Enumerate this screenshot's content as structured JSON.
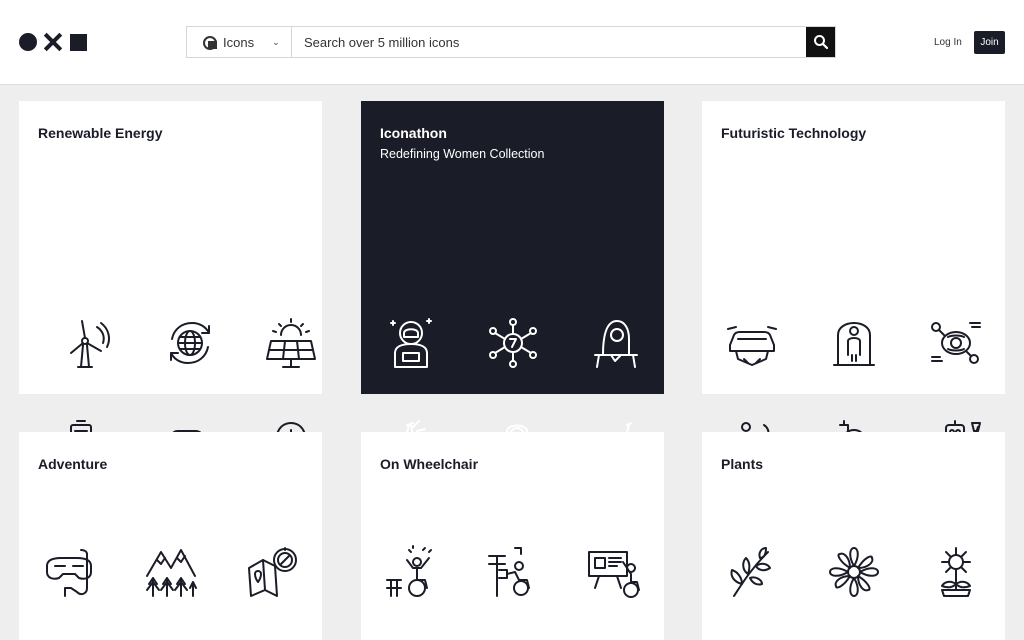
{
  "header": {
    "logo_icons": [
      "circle-icon",
      "cross-icon",
      "square-icon"
    ],
    "search": {
      "type_label": "Icons",
      "placeholder": "Search over 5 million icons"
    },
    "login_label": "Log In",
    "join_label": "Join"
  },
  "collections": [
    {
      "title": "Renewable Energy",
      "subtitle": "",
      "dark": false,
      "icons": [
        "wind-turbine-icon",
        "globe-recycle-icon",
        "solar-panel-icon",
        "battery-recharge-icon",
        "electric-car-icon",
        "lightbulb-gear-icon"
      ]
    },
    {
      "title": "Iconathon",
      "subtitle": "Redefining Women Collection",
      "dark": true,
      "icons": [
        "astronaut-icon",
        "network-woman-icon",
        "hijab-woman-icon",
        "high-five-icon",
        "scientist-woman-icon",
        "group-raised-hand-icon"
      ]
    },
    {
      "title": "Futuristic Technology",
      "subtitle": "",
      "dark": false,
      "icons": [
        "flying-car-icon",
        "teleport-capsule-icon",
        "brain-network-icon",
        "hologram-person-icon",
        "ufo-icon",
        "robot-icon"
      ]
    },
    {
      "title": "Adventure",
      "subtitle": "",
      "dark": false,
      "icons": [
        "snorkel-mask-icon",
        "mountains-forest-icon",
        "map-compass-icon"
      ]
    },
    {
      "title": "On Wheelchair",
      "subtitle": "",
      "dark": false,
      "icons": [
        "wheelchair-celebrate-icon",
        "wheelchair-sign-icon",
        "wheelchair-presentation-icon"
      ]
    },
    {
      "title": "Plants",
      "subtitle": "",
      "dark": false,
      "icons": [
        "leafy-branch-icon",
        "flower-icon",
        "sunflower-pot-icon"
      ]
    }
  ],
  "colors": {
    "dark_card": "#1a1c27",
    "page_background": "#eeeeee",
    "card_background": "#ffffff"
  }
}
